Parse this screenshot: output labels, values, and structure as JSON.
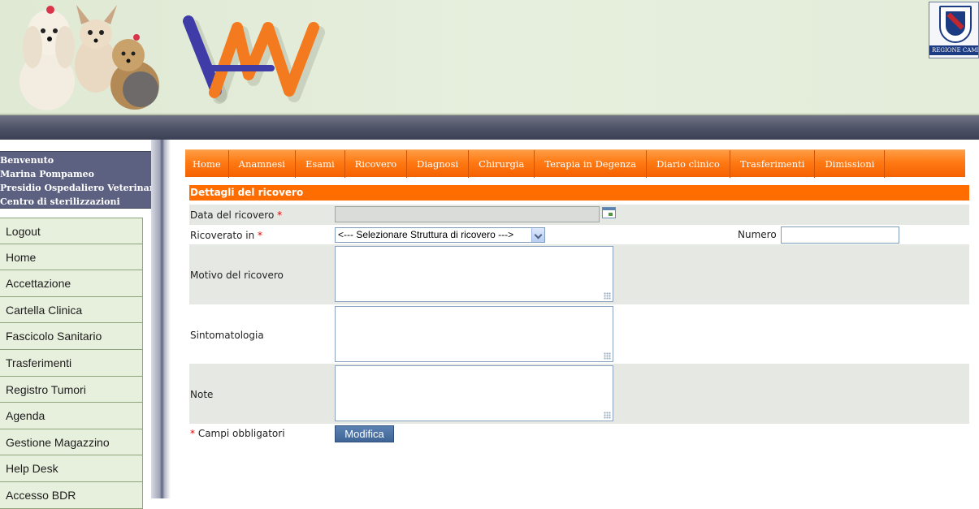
{
  "header": {
    "region_badge_text": "REGIONE CAMPANIA"
  },
  "sidebar": {
    "user": {
      "greeting": "Benvenuto",
      "name": "Marina Pompameo",
      "facility": "Presidio Ospedaliero Veterinario",
      "center": "Centro di sterilizzazioni"
    },
    "items": [
      {
        "label": "Logout"
      },
      {
        "label": "Home"
      },
      {
        "label": "Accettazione"
      },
      {
        "label": "Cartella Clinica"
      },
      {
        "label": "Fascicolo Sanitario"
      },
      {
        "label": "Trasferimenti"
      },
      {
        "label": "Registro Tumori"
      },
      {
        "label": "Agenda"
      },
      {
        "label": "Gestione Magazzino"
      },
      {
        "label": "Help Desk"
      },
      {
        "label": "Accesso BDR"
      }
    ]
  },
  "tabs": [
    {
      "label": "Home"
    },
    {
      "label": "Anamnesi"
    },
    {
      "label": "Esami"
    },
    {
      "label": "Ricovero"
    },
    {
      "label": "Diagnosi"
    },
    {
      "label": "Chirurgia"
    },
    {
      "label": "Terapia in Degenza"
    },
    {
      "label": "Diario clinico"
    },
    {
      "label": "Trasferimenti"
    },
    {
      "label": "Dimissioni"
    }
  ],
  "form": {
    "title": "Dettagli del ricovero",
    "required_mark": "*",
    "date_label": "Data del ricovero",
    "date_value": "",
    "ricoverato_label": "Ricoverato in",
    "ricoverato_selected": "<--- Selezionare Struttura di ricovero --->",
    "numero_label": "Numero",
    "numero_value": "",
    "motivo_label": "Motivo del ricovero",
    "motivo_value": "",
    "sintomatologia_label": "Sintomatologia",
    "sintomatologia_value": "",
    "note_label": "Note",
    "note_value": "",
    "required_note": "Campi obbligatori",
    "submit_label": "Modifica"
  },
  "colors": {
    "accent_orange": "#ff6c00",
    "nav_band": "#4e5266",
    "sidebar_bg": "#e7f0dd",
    "button_blue": "#4a72a6"
  }
}
